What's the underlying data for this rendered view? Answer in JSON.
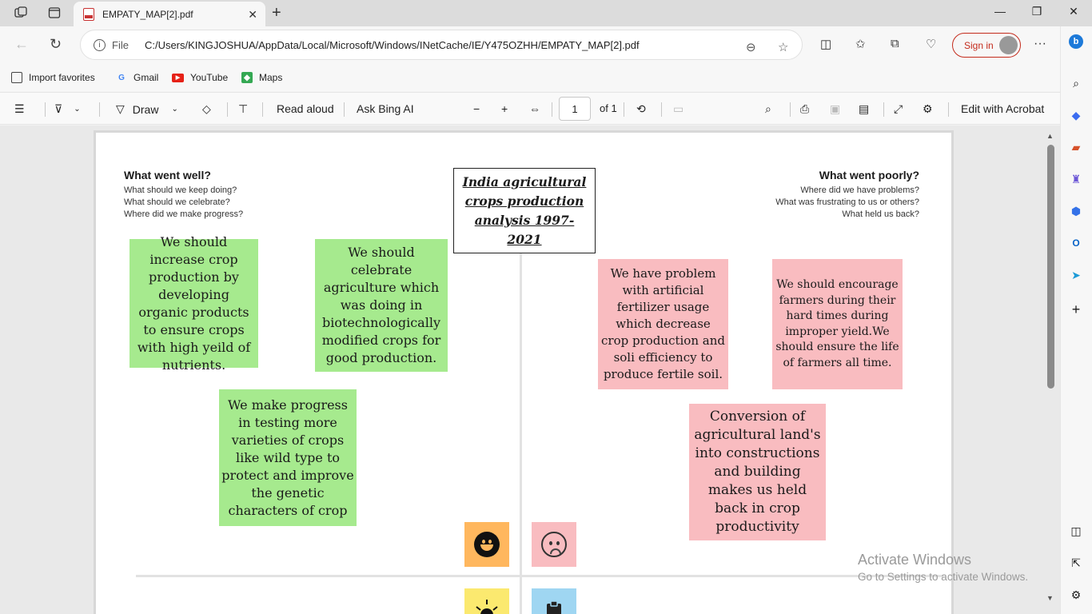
{
  "browser": {
    "tab_title": "EMPATY_MAP[2].pdf",
    "address_label": "File",
    "url": "C:/Users/KINGJOSHUA/AppData/Local/Microsoft/Windows/INetCache/IE/Y475OZHH/EMPATY_MAP[2].pdf",
    "signin_label": "Sign in"
  },
  "favorites": [
    {
      "label": "Import favorites",
      "icon": "import-icon"
    },
    {
      "label": "Gmail",
      "icon": "google-icon"
    },
    {
      "label": "YouTube",
      "icon": "youtube-icon"
    },
    {
      "label": "Maps",
      "icon": "maps-icon"
    }
  ],
  "pdf_toolbar": {
    "draw_label": "Draw",
    "read_aloud_label": "Read aloud",
    "ask_bing_label": "Ask Bing AI",
    "page_number": "1",
    "page_total": "of 1",
    "edit_acrobat_label": "Edit with Acrobat"
  },
  "document": {
    "left_heading": "What went well?",
    "left_prompts": [
      "What should we keep doing?",
      "What should we celebrate?",
      "Where did we make progress?"
    ],
    "right_heading": "What went poorly?",
    "right_prompts": [
      "Where did we have problems?",
      "What was frustrating to us or others?",
      "What held us back?"
    ],
    "title": "India agricultural crops production analysis 1997-2021",
    "green_notes": [
      "We should increase crop production by developing organic products to ensure crops with high yeild of nutrients.",
      "We should celebrate agriculture which was doing in biotechnologically modified crops for good production.",
      "We make progress in testing more varieties of crops like wild type to protect and improve the genetic characters of crop"
    ],
    "pink_notes": [
      "We have problem with artificial fertilizer usage which decrease crop production and soli efficiency to produce fertile soil.",
      "We should encourage farmers during their hard times during improper yield.We should ensure the life of farmers all time.",
      "Conversion of agricultural land's into constructions and building makes us held back in crop productivity"
    ]
  },
  "watermark": {
    "line1": "Activate Windows",
    "line2": "Go to Settings to activate Windows."
  },
  "colors": {
    "green_note": "#a6ea8e",
    "pink_note": "#f9bcc0",
    "happy_tile": "#ffb75e",
    "sad_tile": "#f9bcc0",
    "sun_tile": "#fbe96f",
    "clipboard_tile": "#9fd6f2",
    "signin_accent": "#c42b1c"
  }
}
